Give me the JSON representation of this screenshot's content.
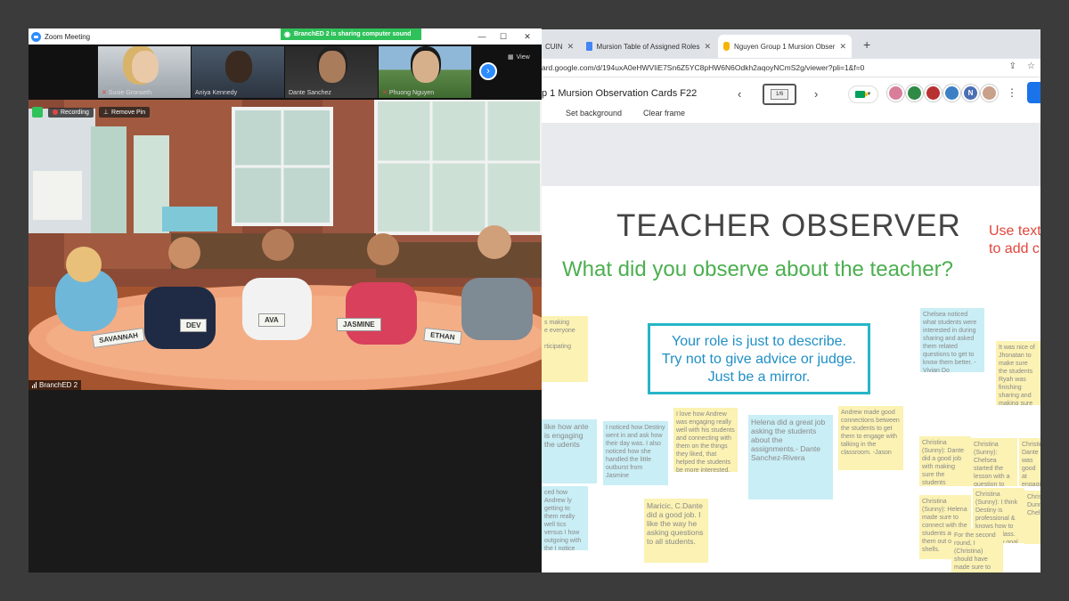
{
  "zoom": {
    "window_title": "Zoom Meeting",
    "share_banner": "BranchED 2 is sharing computer sound",
    "controls": {
      "minimize": "—",
      "maximize": "☐",
      "close": "✕"
    },
    "participants": [
      {
        "name": "Susie Gronseth",
        "muted": true
      },
      {
        "name": "Aniya Kennedy",
        "muted": false
      },
      {
        "name": "Dante Sanchez",
        "muted": false
      },
      {
        "name": "Phuong Nguyen",
        "muted": true
      }
    ],
    "view_label": "View",
    "recording_label": "Recording",
    "remove_pin_label": "Remove Pin",
    "active_speaker_label": "BranchED 2",
    "nameplates": [
      "SAVANNAH",
      "DEV",
      "AVA",
      "JASMINE",
      "ETHAN"
    ]
  },
  "browser": {
    "tabs": [
      {
        "label": "CUIN",
        "icon": "generic-icon"
      },
      {
        "label": "Mursion Table of Assigned Roles",
        "icon": "docs-icon"
      },
      {
        "label": "Nguyen Group 1 Mursion Obser",
        "icon": "jamboard-icon"
      }
    ],
    "new_tab": "+",
    "url": "ard.google.com/d/194uxA0eHWVIiE7Sn6Z5YC8pHW6N6Odkh2aqoyNCmS2g/viewer?pli=1&f=0"
  },
  "jamboard": {
    "title": "p 1 Mursion Observation Cards F22",
    "frame_indicator": "1/6",
    "set_background": "Set background",
    "clear_frame": "Clear frame",
    "avatar_letter": "N",
    "heading": "TEACHER OBSERVER",
    "side_text_line1": "Use text",
    "side_text_line2": "to add c",
    "question": "What did you observe about the teacher?",
    "role_box": {
      "line1": "Your role is just to describe.",
      "line2": "Try not to give advice or judge.",
      "line3": "Just be a mirror."
    },
    "notes": [
      "s making\ne everyone\n\nrticipating",
      "Chelsea noticed what students were interested in during sharing and asked them related questions to get to know them better. -Vivian Do",
      "It was nice of Jhonatan to make sure the students Ryah was finishing sharing and making sure to call on Savannah and still manage to get her to share at least one idea.",
      "like how ante is engaging the udents",
      "I noticed how Destiny went in and ask how their day was. I also noticed how she handled the little outburst from Jasmine",
      "I love how Andrew was engaging really well with his students and connecting with them on the things they liked, that helped the students be more interested.",
      "Helena did a great job asking the students about the assignments.- Dante Sanchez-Rivera",
      "Andrew made good connections between the students to get them to engage with talking in the classroom. -Jason",
      "Christina (Sunny): Dante did a good job with making sure the students participated. He included the quiet students by asking them questions.",
      "Christina (Sunny): Chelsea started the lesson with a question to engage the students and make sure they are all on the same page with the assignment, she kept leading questions.",
      "Christina: Dante was good at engaging students in class.",
      "ced how Andrew ly getting to them really well tics versus I how outgoing with the I notice how nities Ava being phone",
      "Maricic, C.Dante did a good job. I like the way he asking questions to all students.",
      "Christina (Sunny): Helena made sure to connect with the students and get them out of their shells.",
      "Christina (Sunny): I think Destiny is professional & knows how to lead the class. She's very goal focused, so she spends enough the lesson.",
      "For the second round, I (Christina) should have made sure to get students interested in each other's responses by relating them to",
      "Christina Dunn: Chelsea..."
    ]
  },
  "colors": {
    "zoom_blue": "#2d8cff",
    "share_green": "#2fc25b",
    "heading_gray": "#444444",
    "question_green": "#4caf50",
    "role_border": "#26b5c6",
    "role_text": "#1f8fc6",
    "side_text_red": "#e0463a",
    "note_yellow": "#fbf2b3",
    "note_blue": "#c9eef5"
  }
}
